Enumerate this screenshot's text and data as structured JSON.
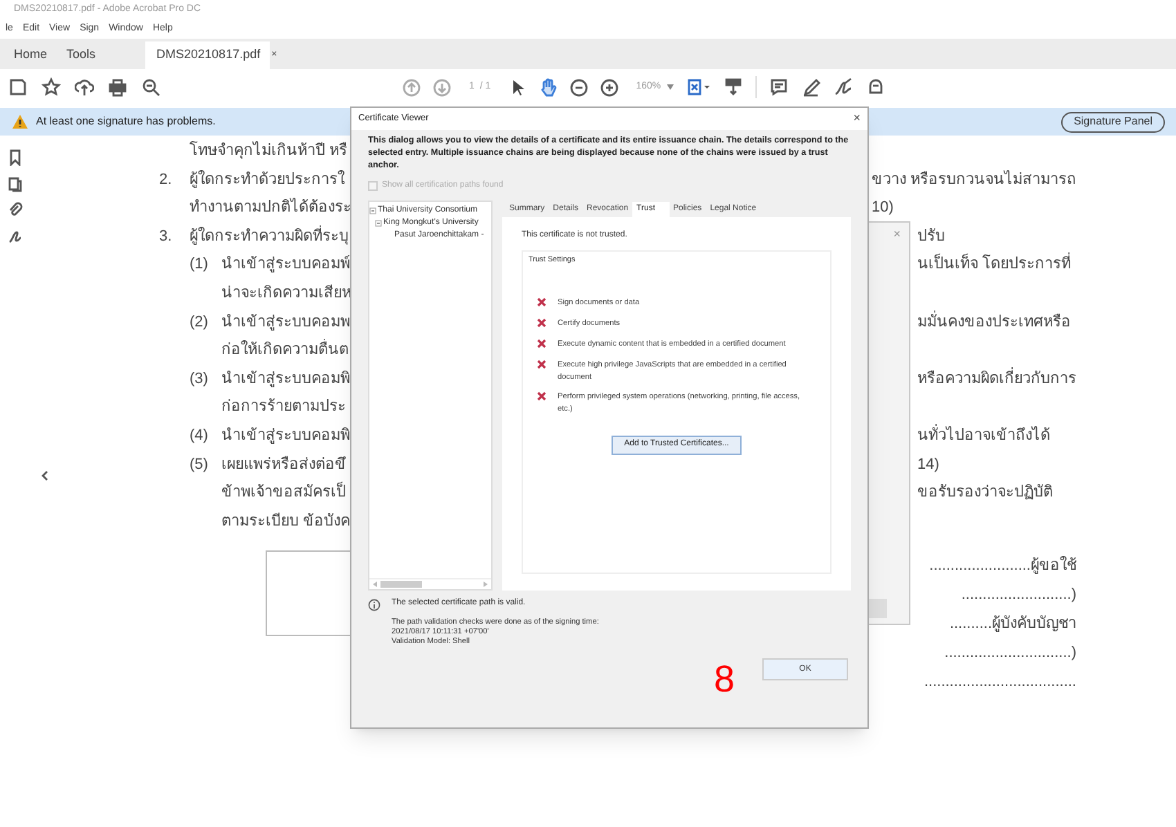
{
  "window": {
    "title": "DMS20210817.pdf - Adobe Acrobat Pro DC"
  },
  "menu": [
    "le",
    "Edit",
    "View",
    "Sign",
    "Window",
    "Help"
  ],
  "tabs": [
    {
      "label": "Home",
      "selected": false
    },
    {
      "label": "Tools",
      "selected": false
    },
    {
      "label": "DMS20210817.pdf",
      "selected": true,
      "close": "×"
    }
  ],
  "toolbar": {
    "page": "1",
    "page_count": "/ 1",
    "zoom": "160%"
  },
  "notice": {
    "text": "At least one signature has problems.",
    "button": "Signature Panel"
  },
  "document": {
    "lines": [
      {
        "left": "โทษจำคุกไม่เกินห้าปี หรื",
        "kind": "item"
      },
      {
        "marker": "2.",
        "left": "ผู้ใดกระทำด้วยประการใ",
        "right": "ขวาง หรือรบกวนจนไม่สามารถ",
        "kind": "item"
      },
      {
        "left": "ทำงานตามปกติได้ต้องระ",
        "right": "10)",
        "kind": "item"
      },
      {
        "marker": "3.",
        "left": "ผู้ใดกระทำความผิดที่ระบุ",
        "right": "ปรับ",
        "kind": "item"
      },
      {
        "marker": "(1)",
        "left": "นำเข้าสู่ระบบคอมพ์",
        "right": "นเป็นเท็จ โดยประการที่",
        "kind": "subitem"
      },
      {
        "left": "น่าจะเกิดความเสียห",
        "kind": "subitem"
      },
      {
        "marker": "(2)",
        "left": "นำเข้าสู่ระบบคอมพ",
        "right": "มมั่นคงของประเทศหรือ",
        "kind": "subitem"
      },
      {
        "left": "ก่อให้เกิดความตื่นต",
        "kind": "subitem"
      },
      {
        "marker": "(3)",
        "left": "นำเข้าสู่ระบบคอมพิ",
        "right": "หรือความผิดเกี่ยวกับการ",
        "kind": "subitem"
      },
      {
        "left": "ก่อการร้ายตามประ",
        "kind": "subitem"
      },
      {
        "marker": "(4)",
        "left": "นำเข้าสู่ระบบคอมพิ",
        "right": "นทั่วไปอาจเข้าถึงได้",
        "kind": "subitem"
      },
      {
        "marker": "(5)",
        "left": "เผยแพร่หรือส่งต่อขึ",
        "right": "14)",
        "kind": "subitem"
      },
      {
        "left": "ข้าพเจ้าขอสมัครเป็",
        "right": "ขอรับรองว่าจะปฏิบัติ",
        "kind": "subitem"
      },
      {
        "left": "ตามระเบียบ ข้อบังค",
        "kind": "subitem"
      }
    ],
    "signatures": [
      "........................ผู้ขอใช้",
      "..........................)",
      "..........ผู้บังคับบัญชา",
      "..............................)",
      "...................................."
    ]
  },
  "back_dialog": {
    "close": "×"
  },
  "dialog": {
    "title": "Certificate Viewer",
    "close": "×",
    "intro": "This dialog allows you to view the details of a certificate and its entire issuance chain. The details correspond to the selected entry. Multiple issuance chains are being displayed because none of the chains were issued by a trust anchor.",
    "show_all": {
      "label": "Show all certification paths found",
      "checked": false,
      "disabled": true
    },
    "tree": [
      {
        "label": "Thai University Consortium",
        "expanded": true,
        "children": [
          {
            "label": "King Mongkut's University",
            "expanded": true,
            "children": [
              {
                "label": "Pasut Jaroenchittakam -"
              }
            ]
          }
        ]
      }
    ],
    "tabs": [
      {
        "label": "Summary",
        "selected": false
      },
      {
        "label": "Details",
        "selected": false
      },
      {
        "label": "Revocation",
        "selected": false
      },
      {
        "label": "Trust",
        "selected": true
      },
      {
        "label": "Policies",
        "selected": false
      },
      {
        "label": "Legal Notice",
        "selected": false
      }
    ],
    "trust_status": "This certificate is not trusted.",
    "trust_settings_label": "Trust Settings",
    "trust_settings": [
      {
        "label": "Sign documents or data",
        "allowed": false
      },
      {
        "label": "Certify documents",
        "allowed": false
      },
      {
        "label": "Execute dynamic content that is embedded in a certified document",
        "allowed": false
      },
      {
        "label": "Execute high privilege JavaScripts that are embedded in a certified document",
        "allowed": false
      },
      {
        "label": "Perform privileged system operations (networking, printing, file access, etc.)",
        "allowed": false
      }
    ],
    "add_button": "Add to Trusted Certificates...",
    "path_status": "The selected certificate path is valid.",
    "validation": [
      "The path validation checks were done as of the signing time:",
      "2021/08/17 10:11:31 +07'00'",
      "Validation Model: Shell"
    ],
    "ok": "OK"
  },
  "annotation": "8"
}
